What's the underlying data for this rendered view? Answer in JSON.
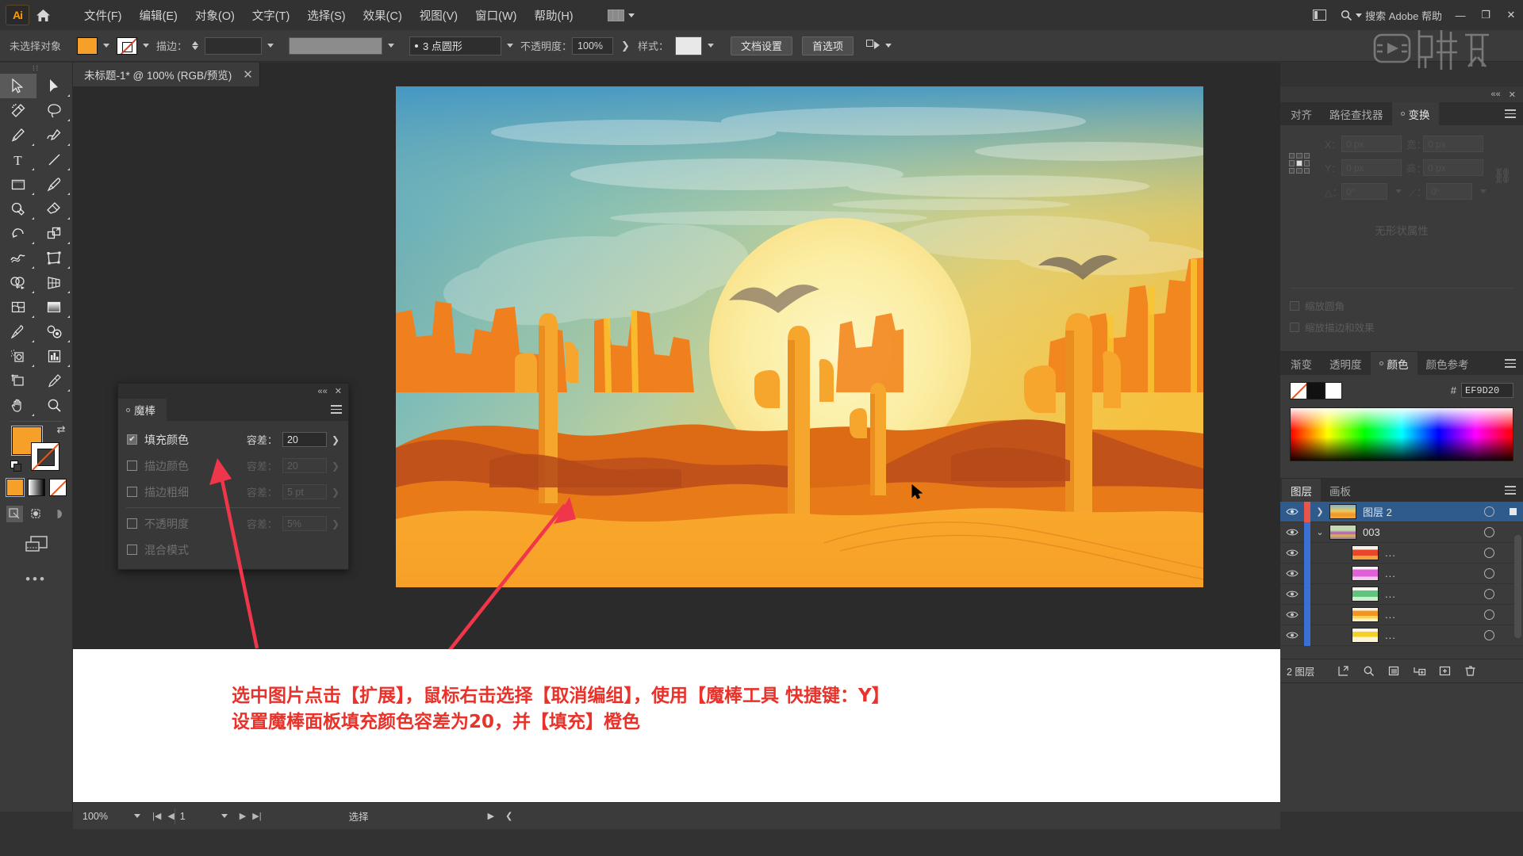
{
  "app": {
    "logo": "Ai",
    "name": "Adobe Illustrator"
  },
  "menubar": {
    "items": [
      {
        "label": "文件(F)",
        "name": "menu-file"
      },
      {
        "label": "编辑(E)",
        "name": "menu-edit"
      },
      {
        "label": "对象(O)",
        "name": "menu-object"
      },
      {
        "label": "文字(T)",
        "name": "menu-type"
      },
      {
        "label": "选择(S)",
        "name": "menu-select"
      },
      {
        "label": "效果(C)",
        "name": "menu-effect"
      },
      {
        "label": "视图(V)",
        "name": "menu-view"
      },
      {
        "label": "窗口(W)",
        "name": "menu-window"
      },
      {
        "label": "帮助(H)",
        "name": "menu-help"
      }
    ],
    "search_placeholder": "搜索 Adobe 帮助",
    "minimize": "—",
    "maximize": "❐",
    "close": "✕"
  },
  "controlbar": {
    "selection_status": "未选择对象",
    "fill_color": "#F6A02A",
    "stroke_color": "none",
    "stroke_label": "描边：",
    "stroke_weight": "",
    "stroke_profile": "3 点圆形",
    "opacity_label": "不透明度：",
    "opacity_value": "100%",
    "style_label": "样式：",
    "document_setup": "文档设置",
    "preferences": "首选项"
  },
  "tab": {
    "title": "未标题-1* @ 100% (RGB/预览)",
    "close": "✕"
  },
  "toolbar": {
    "tools": [
      {
        "name": "selection-tool",
        "glyph": "selection",
        "selected": true
      },
      {
        "name": "direct-selection-tool",
        "glyph": "direct"
      },
      {
        "name": "magic-wand-tool",
        "glyph": "wand"
      },
      {
        "name": "lasso-tool",
        "glyph": "lasso"
      },
      {
        "name": "pen-tool",
        "glyph": "pen"
      },
      {
        "name": "curvature-tool",
        "glyph": "curvature"
      },
      {
        "name": "type-tool",
        "glyph": "type"
      },
      {
        "name": "line-segment-tool",
        "glyph": "line"
      },
      {
        "name": "rectangle-tool",
        "glyph": "rect"
      },
      {
        "name": "paintbrush-tool",
        "glyph": "brush"
      },
      {
        "name": "shaper-tool",
        "glyph": "shaper"
      },
      {
        "name": "eraser-tool",
        "glyph": "eraser"
      },
      {
        "name": "rotate-tool",
        "glyph": "rotate"
      },
      {
        "name": "scale-tool",
        "glyph": "scale"
      },
      {
        "name": "width-tool",
        "glyph": "width"
      },
      {
        "name": "free-transform-tool",
        "glyph": "freetransform"
      },
      {
        "name": "shape-builder-tool",
        "glyph": "shapebuilder"
      },
      {
        "name": "perspective-grid-tool",
        "glyph": "perspective"
      },
      {
        "name": "mesh-tool",
        "glyph": "mesh"
      },
      {
        "name": "gradient-tool",
        "glyph": "gradient"
      },
      {
        "name": "eyedropper-tool",
        "glyph": "eyedropper"
      },
      {
        "name": "blend-tool",
        "glyph": "blend"
      },
      {
        "name": "symbol-sprayer-tool",
        "glyph": "symbol"
      },
      {
        "name": "column-graph-tool",
        "glyph": "graph"
      },
      {
        "name": "artboard-tool",
        "glyph": "artboard"
      },
      {
        "name": "slice-tool",
        "glyph": "slice"
      },
      {
        "name": "hand-tool",
        "glyph": "hand"
      },
      {
        "name": "zoom-tool",
        "glyph": "zoom"
      }
    ],
    "fill_color": "#F6A02A",
    "stroke_color": "none",
    "color_modes": [
      "color",
      "gradient",
      "none"
    ],
    "draw_modes": [
      "draw-normal",
      "draw-behind",
      "draw-inside"
    ]
  },
  "magic_wand_panel": {
    "title": "魔棒",
    "collapse": "««",
    "close": "✕",
    "rows": [
      {
        "label": "填充颜色",
        "checked": true,
        "tol_label": "容差：",
        "tol_value": "20",
        "enabled": true
      },
      {
        "label": "描边颜色",
        "checked": false,
        "tol_label": "容差：",
        "tol_value": "20",
        "enabled": false
      },
      {
        "label": "描边粗细",
        "checked": false,
        "tol_label": "容差：",
        "tol_value": "5 pt",
        "enabled": false
      },
      {
        "label": "不透明度",
        "checked": false,
        "tol_label": "容差：",
        "tol_value": "5%",
        "enabled": false
      },
      {
        "label": "混合模式",
        "checked": false,
        "tol_label": "",
        "tol_value": "",
        "enabled": false
      }
    ]
  },
  "transform_group": {
    "tabs": [
      {
        "label": "对齐",
        "name": "tab-align",
        "active": false
      },
      {
        "label": "路径查找器",
        "name": "tab-pathfinder",
        "active": false
      },
      {
        "label": "变换",
        "name": "tab-transform",
        "active": true
      }
    ],
    "fields": [
      {
        "key": "X：",
        "value": "0 px"
      },
      {
        "key": "宽：",
        "value": "0 px"
      },
      {
        "key": "Y：",
        "value": "0 px"
      },
      {
        "key": "高：",
        "value": "0 px"
      },
      {
        "key": "△：",
        "value": "0°"
      },
      {
        "key": "⟋：",
        "value": "0°"
      }
    ],
    "no_shape_properties": "无形状属性",
    "options": [
      {
        "label": "缩放圆角",
        "checked": false
      },
      {
        "label": "缩放描边和效果",
        "checked": false
      }
    ]
  },
  "color_group": {
    "tabs": [
      {
        "label": "渐变",
        "name": "tab-gradient",
        "active": false
      },
      {
        "label": "透明度",
        "name": "tab-transparency",
        "active": false
      },
      {
        "label": "颜色",
        "name": "tab-color",
        "active": true
      },
      {
        "label": "颜色参考",
        "name": "tab-color-guide",
        "active": false
      }
    ],
    "hash": "#",
    "hex_value": "EF9D20",
    "swatch_none": "none",
    "swatch_black": "#000000",
    "swatch_white": "#FFFFFF"
  },
  "layers_group": {
    "tabs": [
      {
        "label": "图层",
        "name": "tab-layers",
        "active": true
      },
      {
        "label": "画板",
        "name": "tab-artboards",
        "active": false
      }
    ],
    "rows": [
      {
        "name": "图层 2",
        "indent": 0,
        "selected": true,
        "expanded": false,
        "bar": "#E8564B",
        "thumb": "art",
        "visible": true
      },
      {
        "name": "003",
        "indent": 1,
        "selected": false,
        "expanded": true,
        "bar": "#3B6FD4",
        "thumb": "multi",
        "visible": true
      },
      {
        "name": "...",
        "indent": 2,
        "selected": false,
        "expanded": null,
        "bar": "#3B6FD4",
        "thumb": "red",
        "visible": true
      },
      {
        "name": "...",
        "indent": 2,
        "selected": false,
        "expanded": null,
        "bar": "#3B6FD4",
        "thumb": "pink",
        "visible": true
      },
      {
        "name": "...",
        "indent": 2,
        "selected": false,
        "expanded": null,
        "bar": "#3B6FD4",
        "thumb": "green",
        "visible": true
      },
      {
        "name": "...",
        "indent": 2,
        "selected": false,
        "expanded": null,
        "bar": "#3B6FD4",
        "thumb": "orange",
        "visible": true
      },
      {
        "name": "...",
        "indent": 2,
        "selected": false,
        "expanded": null,
        "bar": "#3B6FD4",
        "thumb": "yellow",
        "visible": true
      }
    ],
    "footer_count": "2 图层",
    "footer_icons": [
      "locate-object",
      "search",
      "new-sublayer",
      "new-layer",
      "delete-layer"
    ]
  },
  "statusbar": {
    "zoom": "100%",
    "page": "1",
    "tool_status": "选择"
  },
  "annotation": {
    "line1": "选中图片点击【扩展】，鼠标右击选择【取消编组】，使用【魔棒工具 快捷键：Y】",
    "line2": "设置魔棒面板填充颜色容差为20，并【填充】橙色",
    "color": "#E8322A"
  },
  "artwork": {
    "description": "沙漠日落插画",
    "sky_top": "#4FA3CE",
    "sky_mid": "#9FC8A8",
    "sky_warm": "#F2C94C",
    "sun": "#FBEFA0",
    "sand": "#F7A72B",
    "mesa": "#F07C1E",
    "mesa_dark": "#C9521A",
    "cactus": "#F6A62C"
  },
  "watermark": {
    "text": "虎课网"
  }
}
